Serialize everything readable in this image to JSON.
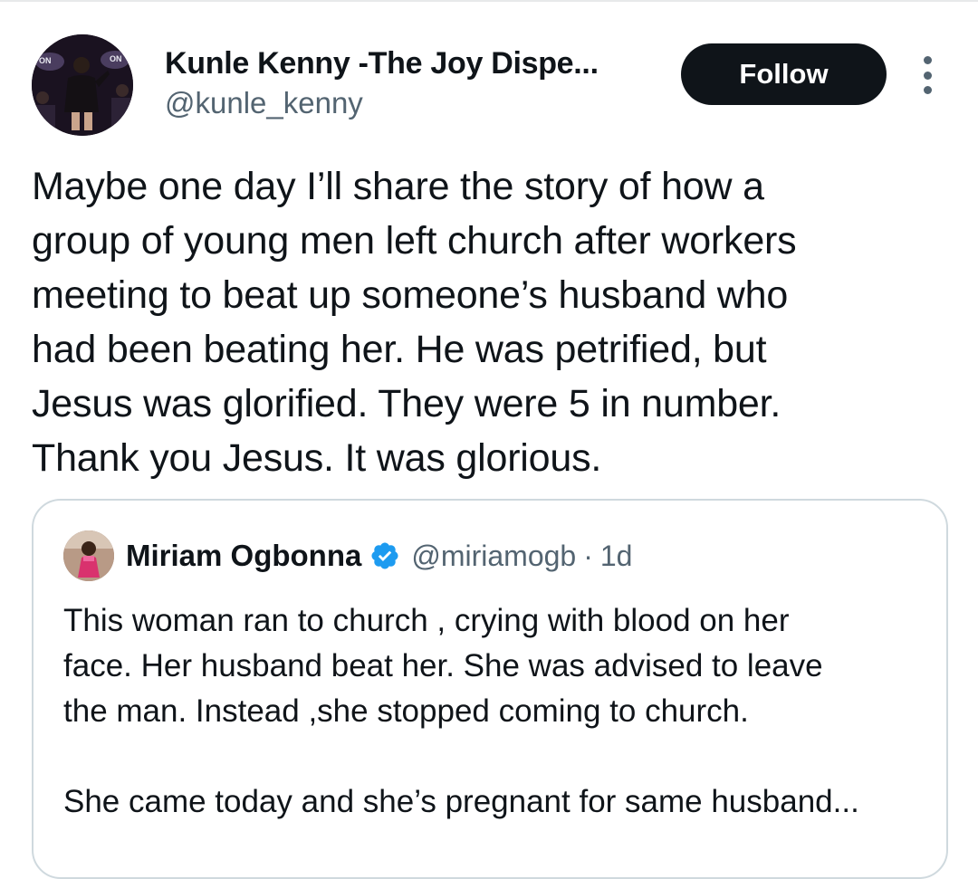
{
  "author": {
    "display_name": "Kunle Kenny -The Joy Dispe...",
    "handle": "@kunle_kenny",
    "avatar_icon": "profile-photo-stage-performer"
  },
  "actions": {
    "follow_label": "Follow",
    "more_icon": "more-vertical-icon"
  },
  "tweet": {
    "lines": [
      "Maybe one day I’ll share the story of how a",
      "group of young men left church after workers",
      "meeting to beat up someone’s husband who",
      "had been beating her. He was petrified, but",
      "Jesus was glorified. They were 5 in number.",
      "Thank you Jesus. It was glorious."
    ]
  },
  "quoted": {
    "display_name": "Miriam Ogbonna",
    "verified_icon": "verified-badge-icon",
    "handle": "@miriamogb",
    "separator": "·",
    "time": "1d",
    "paragraph1": [
      "This woman ran to church , crying with blood on her",
      "face. Her husband beat her. She was advised to leave",
      "the man. Instead ,she stopped coming to church."
    ],
    "paragraph2": [
      "She came today and she’s pregnant for same husband..."
    ]
  },
  "colors": {
    "text": "#0f1419",
    "secondary": "#536471",
    "border": "#cfd9de",
    "verified": "#1d9bf0",
    "button": "#0f1419"
  }
}
